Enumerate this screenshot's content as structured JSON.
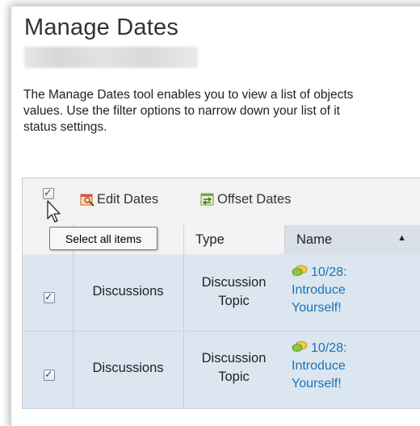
{
  "page": {
    "title": "Manage Dates",
    "description_lines": [
      "The Manage Dates tool enables you to view a list of objects",
      "values. Use the filter options to narrow down your list of it",
      "status settings."
    ]
  },
  "toolbar": {
    "edit_dates_label": "Edit Dates",
    "offset_dates_label": "Offset Dates"
  },
  "tooltip": {
    "select_all": "Select all items"
  },
  "table": {
    "columns": {
      "type": "Type",
      "name": "Name"
    },
    "rows": [
      {
        "checked": true,
        "tool": "Discussions",
        "type_line1": "Discussion",
        "type_line2": "Topic",
        "name_date": "10/28:",
        "name_line1": "Introduce",
        "name_line2": "Yourself!"
      },
      {
        "checked": true,
        "tool": "Discussions",
        "type_line1": "Discussion",
        "type_line2": "Topic",
        "name_date": "10/28:",
        "name_line1": "Introduce",
        "name_line2": "Yourself!"
      }
    ]
  },
  "icons": {
    "edit": "edit-dates-icon",
    "offset": "offset-dates-icon",
    "discussion": "discussion-bubbles-icon",
    "cursor": "mouse-pointer-icon"
  },
  "colors": {
    "link": "#1a73b8",
    "selected_row": "#dce6f0",
    "header_bg": "#f3f3f3",
    "sorted_header": "#d9e0e8"
  }
}
